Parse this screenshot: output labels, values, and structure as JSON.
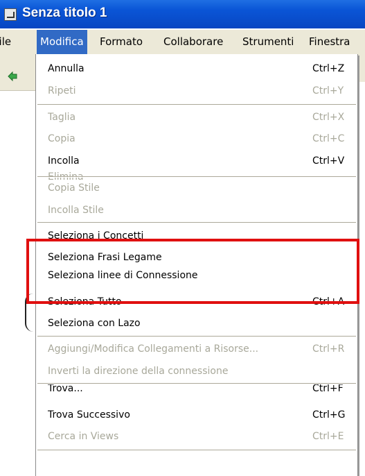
{
  "window": {
    "title": "Senza titolo 1"
  },
  "menubar": {
    "items": [
      {
        "label": "File"
      },
      {
        "label": "Modifica"
      },
      {
        "label": "Formato"
      },
      {
        "label": "Collaborare"
      },
      {
        "label": "Strumenti"
      },
      {
        "label": "Finestra"
      }
    ],
    "active": "Modifica"
  },
  "menu": {
    "items": [
      {
        "label": "Annulla",
        "shortcut": "Ctrl+Z",
        "enabled": true
      },
      {
        "label": "Ripeti",
        "shortcut": "Ctrl+Y",
        "enabled": false
      },
      {
        "label": "Taglia",
        "shortcut": "Ctrl+X",
        "enabled": false
      },
      {
        "label": "Copia",
        "shortcut": "Ctrl+C",
        "enabled": false
      },
      {
        "label": "Incolla",
        "shortcut": "Ctrl+V",
        "enabled": true
      },
      {
        "label": "Elimina",
        "shortcut": "",
        "enabled": false
      },
      {
        "label": "Copia Stile",
        "shortcut": "",
        "enabled": false
      },
      {
        "label": "Incolla Stile",
        "shortcut": "",
        "enabled": false
      },
      {
        "label": "Seleziona i Concetti",
        "shortcut": "",
        "enabled": true
      },
      {
        "label": "Seleziona Frasi Legame",
        "shortcut": "",
        "enabled": true
      },
      {
        "label": "Seleziona linee di Connessione",
        "shortcut": "",
        "enabled": true
      },
      {
        "label": "Seleziona Tutto",
        "shortcut": "Ctrl+A",
        "enabled": true
      },
      {
        "label": "Seleziona con Lazo",
        "shortcut": "",
        "enabled": true
      },
      {
        "label": "Aggiungi/Modifica Collegamenti a Risorse...",
        "shortcut": "Ctrl+R",
        "enabled": false
      },
      {
        "label": "Inverti la direzione della connessione",
        "shortcut": "",
        "enabled": false
      },
      {
        "label": "Trova...",
        "shortcut": "Ctrl+F",
        "enabled": true
      },
      {
        "label": "Trova Successivo",
        "shortcut": "Ctrl+G",
        "enabled": true
      },
      {
        "label": "Cerca in Views",
        "shortcut": "Ctrl+E",
        "enabled": false
      }
    ]
  },
  "annotation": {
    "color": "#e01010"
  },
  "colors": {
    "titlebar": "#0a55d6",
    "menu_highlight": "#316ac5",
    "menubar_bg": "#ece9d8",
    "disabled_text": "#a8a89a"
  }
}
